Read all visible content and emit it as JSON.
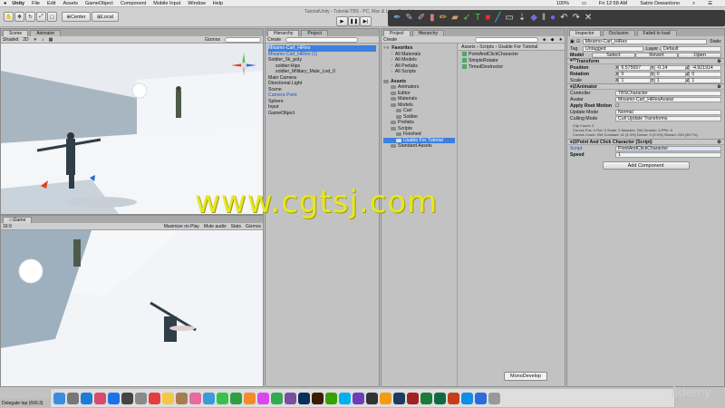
{
  "menubar": {
    "apple": "",
    "items": [
      "Unity",
      "File",
      "Edit",
      "Assets",
      "GameObject",
      "Component",
      "Mobile Input",
      "Window",
      "Help"
    ],
    "battery": "100%",
    "clock": "Fri 12:58 AM",
    "user": "Satrio Dewantono"
  },
  "toolbar": {
    "center_label": "Center",
    "local_label": "Local",
    "window_title": "TutorialUnity - Tutorial-TBS - PC, Mac & Linux Standalone"
  },
  "scene": {
    "tabs": [
      "Scene",
      "Animator"
    ],
    "shaded": "Shaded",
    "mode2d": "2D",
    "gizmos": "Gizmos"
  },
  "game": {
    "tab": "Game",
    "aspect": "16:9",
    "options": [
      "Maximize on Play",
      "Mute audio",
      "Stats",
      "Gizmos"
    ]
  },
  "hierarchy": {
    "tabs": [
      "Hierarchy",
      "Project"
    ],
    "create": "Create",
    "items": [
      {
        "label": "Mixamo-Carl_HiRes",
        "style": "sel"
      },
      {
        "label": "Mixamo-Carl_HiRes (1)",
        "style": "blue"
      },
      {
        "label": "Soldier_5k_poly",
        "style": ""
      },
      {
        "label": "soldier:Hips",
        "style": "indent"
      },
      {
        "label": "soldier_Military_Male_Lod_0",
        "style": "indent"
      },
      {
        "label": "Main Camera",
        "style": ""
      },
      {
        "label": "Directional Light",
        "style": ""
      },
      {
        "label": "Scene",
        "style": ""
      },
      {
        "label": "Camera Point",
        "style": "blue"
      },
      {
        "label": "Sphere",
        "style": ""
      },
      {
        "label": "Input",
        "style": ""
      },
      {
        "label": "GameObject",
        "style": ""
      }
    ]
  },
  "project": {
    "tabs": [
      "Project",
      "Hierarchy"
    ],
    "create": "Create",
    "favorites": {
      "label": "Favorites",
      "items": [
        "All Materials",
        "All Models",
        "All Prefabs",
        "All Scripts"
      ]
    },
    "assets": {
      "label": "Assets",
      "items": [
        {
          "label": "Animators",
          "level": 1
        },
        {
          "label": "Editor",
          "level": 1
        },
        {
          "label": "Materials",
          "level": 1
        },
        {
          "label": "Models",
          "level": 1
        },
        {
          "label": "Carl",
          "level": 2
        },
        {
          "label": "Soldier",
          "level": 2
        },
        {
          "label": "Prefabs",
          "level": 1
        },
        {
          "label": "Scripts",
          "level": 1
        },
        {
          "label": "Finished",
          "level": 2
        },
        {
          "label": "Usable For Tutorial",
          "level": 2,
          "selected": true
        },
        {
          "label": "Standard Assets",
          "level": 1
        }
      ]
    },
    "breadcrumb": "Assets › Scripts › Usable For Tutorial",
    "files": [
      "PointAndClickCharacter",
      "SimpleRotator",
      "TimedDestructor"
    ]
  },
  "inspector": {
    "tabs": [
      "Inspector",
      "Occlusion",
      "Failed to load"
    ],
    "object_name": "Mixamo-Carl_HiRes",
    "static_label": "Static",
    "tag_label": "Tag",
    "tag_value": "Untagged",
    "layer_label": "Layer",
    "layer_value": "Default",
    "model_label": "Model",
    "model_buttons": [
      "Select",
      "Revert",
      "Open"
    ],
    "transform": {
      "title": "Transform",
      "position_label": "Position",
      "position": [
        "6.575657",
        "-0.14",
        "-4.921914"
      ],
      "rotation_label": "Rotation",
      "rotation": [
        "0",
        "0",
        "0"
      ],
      "scale_label": "Scale",
      "scale": [
        "1",
        "1",
        "1"
      ]
    },
    "animator": {
      "title": "Animator",
      "controller_label": "Controller",
      "controller": "TBSCharacter",
      "avatar_label": "Avatar",
      "avatar": "Mixamo-Carl_HiResAvatar",
      "root_motion_label": "Apply Root Motion",
      "update_label": "Update Mode",
      "update": "Normal",
      "culling_label": "Culling Mode",
      "culling": "Cull Update Transforms",
      "info": [
        "Clip Count: 2",
        "Curves Pos: 0 Rot: 0 Scale: 0 Muscles: 254 Generic: 6 PPtr: 0",
        "Curves Count: 254 Constant: 11 (4.3%) Dense: 0 (0.0%) Stream: 243 (95.7%)"
      ]
    },
    "script": {
      "title": "Point And Click Character (Script)",
      "script_label": "Script",
      "script_value": "PointAndClickCharacter",
      "speed_label": "Speed",
      "speed_value": "1"
    },
    "add_component": "Add Component"
  },
  "watermark": "www.cgtsj.com",
  "tooltip": "MonoDevelop",
  "statusbar": "Delegate tap (666:3)",
  "udemy": "ûdemy",
  "dock": {
    "icons": [
      "finder-icon",
      "launchpad-icon",
      "safari-icon",
      "photos-icon",
      "appstore-icon",
      "unity-icon",
      "system-preferences-icon",
      "calendar-icon",
      "notes-icon",
      "contacts-icon",
      "photos2-icon",
      "mail-icon",
      "messages-icon",
      "facetime-icon",
      "ibooks-icon",
      "itunes-icon",
      "chrome-icon",
      "monodevelop-icon",
      "photoshop-icon",
      "illustrator-icon",
      "upwork-icon",
      "skype-icon",
      "visual-studio-icon",
      "unity2-icon",
      "vlc-icon",
      "quicktime-icon",
      "davinci-icon",
      "excel-icon",
      "publisher-icon",
      "powerpoint-icon",
      "teamviewer-icon",
      "network-icon",
      "trash-icon"
    ],
    "colors": [
      "#3b8de0",
      "#777",
      "#1c7cd6",
      "#d84b6b",
      "#1a73e8",
      "#444",
      "#8a8a8a",
      "#e04040",
      "#f2c744",
      "#a67c52",
      "#e86aa1",
      "#3a9bd8",
      "#37c24a",
      "#2f9e44",
      "#f28c28",
      "#d946ef",
      "#34a853",
      "#7a4ea0",
      "#0a2f5a",
      "#3a1c00",
      "#37a000",
      "#00aff0",
      "#6c3fb8",
      "#333",
      "#f39c12",
      "#1e3a5f",
      "#a12222",
      "#1e7a3b",
      "#0f6b3f",
      "#c43e1c",
      "#0e8ee9",
      "#2d6bd8",
      "#999"
    ]
  }
}
